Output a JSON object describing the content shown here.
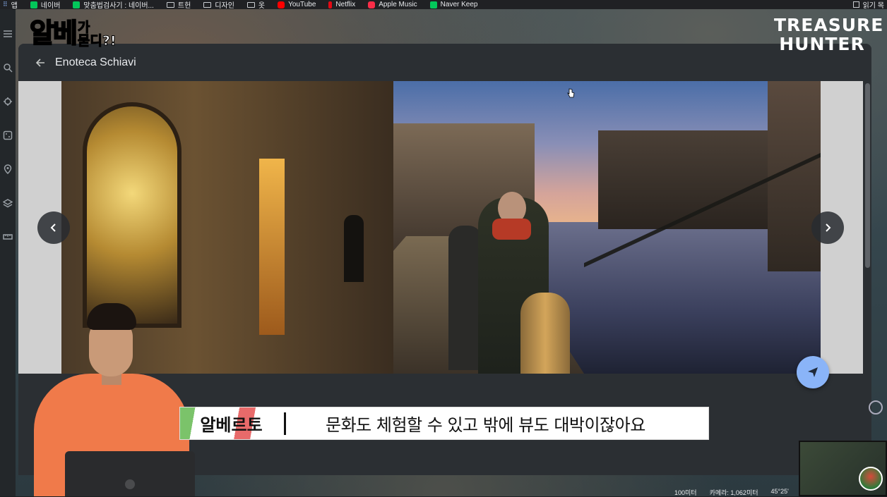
{
  "bookmarks": [
    {
      "label": "앱",
      "icon": "apps-grid-icon"
    },
    {
      "label": "네이버",
      "icon": "naver-icon"
    },
    {
      "label": "맞춤법검사기 : 네이버...",
      "icon": "naver-icon"
    },
    {
      "label": "트헌",
      "icon": "folder-icon"
    },
    {
      "label": "디자인",
      "icon": "folder-icon"
    },
    {
      "label": "옷",
      "icon": "folder-icon"
    },
    {
      "label": "YouTube",
      "icon": "youtube-icon"
    },
    {
      "label": "Netflix",
      "icon": "netflix-icon"
    },
    {
      "label": "Apple Music",
      "icon": "apple-music-icon"
    },
    {
      "label": "Naver Keep",
      "icon": "naver-icon"
    }
  ],
  "reading_list": "읽기 목",
  "place": {
    "title": "Enoteca Schiavi",
    "partial_text": "E"
  },
  "overlay": {
    "show_logo_main": "알베",
    "show_logo_sub_1": "가",
    "show_logo_sub_2": "묻디?!",
    "brand_line_1": "TREASURE",
    "brand_line_2": "HUNTER"
  },
  "subtitle": {
    "speaker": "알베르토",
    "text": "문화도 체험할 수 있고 밖에 뷰도 대박이잖아요"
  },
  "map_footer": {
    "scale": "100미터",
    "camera": "카메라: 1,062미터",
    "coords": "45°25'"
  },
  "colors": {
    "panel_bg": "#2b2f33",
    "fab_bg": "#8ab4f8",
    "logo_yellow": "#ffdb3a"
  }
}
